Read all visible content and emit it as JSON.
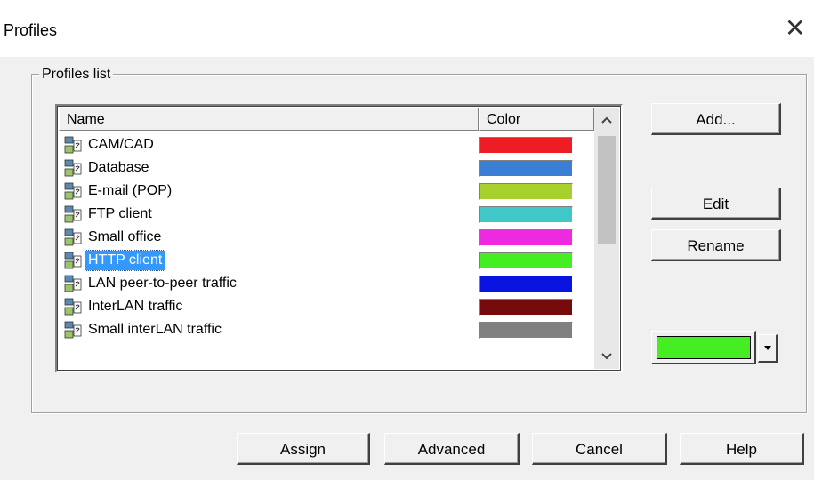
{
  "window": {
    "title": "Profiles",
    "close_glyph": "✕"
  },
  "group": {
    "label": "Profiles list"
  },
  "list": {
    "columns": {
      "name": "Name",
      "color": "Color"
    },
    "selected_index": 5,
    "rows": [
      {
        "name": "CAM/CAD",
        "color": "#ee1c24"
      },
      {
        "name": "Database",
        "color": "#3a7fd5"
      },
      {
        "name": "E-mail (POP)",
        "color": "#a8d02c"
      },
      {
        "name": "FTP client",
        "color": "#40c8c8"
      },
      {
        "name": "Small office",
        "color": "#ee2ae0"
      },
      {
        "name": "HTTP client",
        "color": "#44ee22"
      },
      {
        "name": "LAN peer-to-peer traffic",
        "color": "#0a14e0"
      },
      {
        "name": "InterLAN traffic",
        "color": "#760a0a"
      },
      {
        "name": "Small interLAN traffic",
        "color": "#808080"
      }
    ],
    "scroll_up_icon": "chevron-up-icon",
    "scroll_down_icon": "chevron-down-icon"
  },
  "side_buttons": {
    "add": "Add...",
    "edit": "Edit",
    "rename": "Rename"
  },
  "current_color": {
    "value": "#44ee22",
    "dropdown_icon": "caret-down-icon"
  },
  "footer_buttons": {
    "assign": "Assign",
    "advanced": "Advanced",
    "cancel": "Cancel",
    "help": "Help"
  }
}
